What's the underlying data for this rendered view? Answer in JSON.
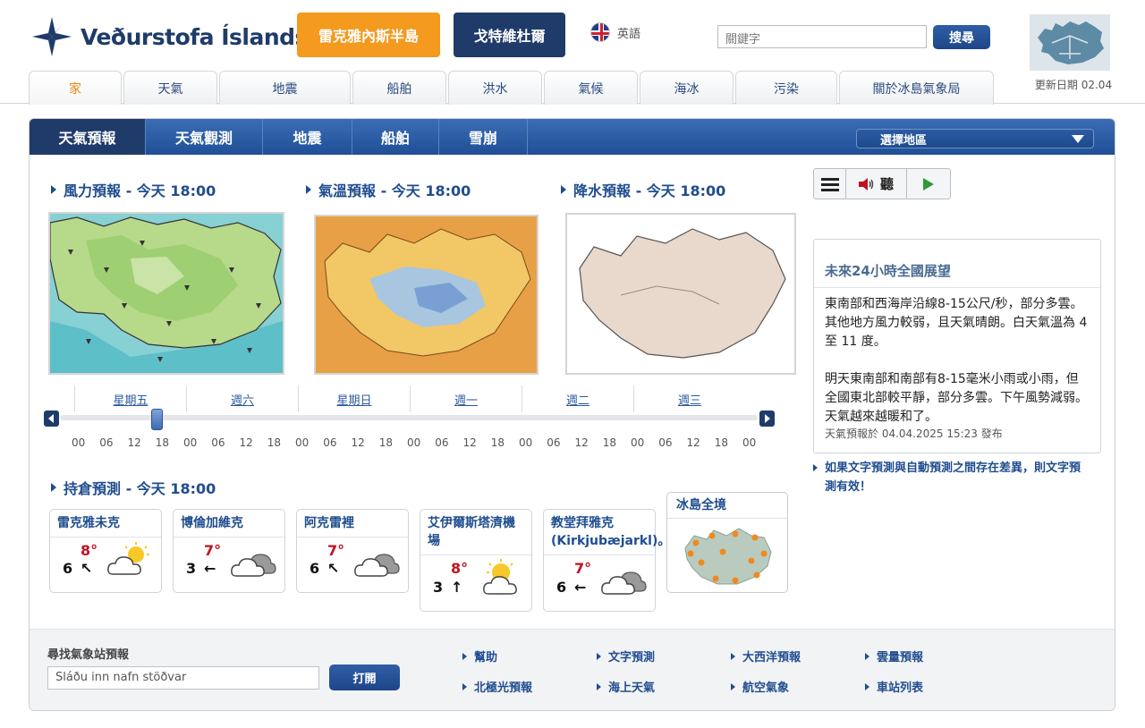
{
  "header": {
    "logo_text": "Veðurstofa Íslands",
    "btn_reykjanes": "雷克雅內斯半島",
    "btn_second": "戈特維杜爾",
    "language": "英語",
    "search_placeholder": "關鍵字",
    "search_button": "搜尋",
    "update": "更新日期 02.04"
  },
  "nav": {
    "tabs": [
      "家",
      "天氣",
      "地震",
      "船舶",
      "洪水",
      "氣候",
      "海冰",
      "污染",
      "關於冰島氣象局"
    ]
  },
  "subnav": {
    "tabs": [
      "天氣預報",
      "天氣觀測",
      "地震",
      "船舶",
      "雪崩"
    ],
    "region": "選擇地區"
  },
  "maps": {
    "wind_title": "風力預報 - 今天 18:00",
    "temp_title": "氣溫預報 - 今天 18:00",
    "precip_title": "降水預報 - 今天 18:00"
  },
  "timeline": {
    "days": [
      "星期五",
      "週六",
      "星期日",
      "週一",
      "週二",
      "週三"
    ],
    "hours": [
      "00",
      "06",
      "12",
      "18",
      "00",
      "06",
      "12",
      "18",
      "00",
      "06",
      "12",
      "18",
      "00",
      "06",
      "12",
      "18",
      "00",
      "06",
      "12",
      "18",
      "00",
      "06",
      "12",
      "18",
      "00"
    ]
  },
  "stations": {
    "title": "持倉預測 - 今天 18:00",
    "items": [
      {
        "name": "雷克雅未克",
        "temp": "8°",
        "wind": "6"
      },
      {
        "name": "博倫加維克",
        "temp": "7°",
        "wind": "3"
      },
      {
        "name": "阿克雷裡",
        "temp": "7°",
        "wind": "6"
      },
      {
        "name": "艾伊爾斯塔濟機場",
        "temp": "8°",
        "wind": "3"
      },
      {
        "name": "教堂拜雅克(Kirkjubæjarkl)。",
        "temp": "7°",
        "wind": "6"
      }
    ],
    "all_iceland": "冰島全境"
  },
  "toolbar": {
    "listen": "聽"
  },
  "outlook": {
    "title": "未來24小時全國展望",
    "para1": "東南部和西海岸沿線8-15公尺/秒，部分多雲。其他地方風力較弱，且天氣晴朗。白天氣溫為 4 至 11 度。",
    "para2": "明天東南部和南部有8-15毫米小雨或小雨，但全國東北部較平靜，部分多雲。下午風勢減弱。天氣越來越暖和了。",
    "footer": "天氣預報於 04.04.2025 15:23 發布",
    "note": "如果文字預測與自動預測之間存在差異，則文字預測有效！"
  },
  "footer": {
    "find_label": "尋找氣象站預報",
    "find_placeholder": "Sláðu inn nafn stöðvar",
    "open_button": "打開",
    "links": [
      "幫助",
      "文字預測",
      "大西洋預報",
      "雲量預報",
      "北極光預報",
      "海上天氣",
      "航空氣象",
      "車站列表"
    ]
  },
  "colors": {
    "brand_navy": "#1f3b6a",
    "accent_orange": "#f39a1f",
    "link_blue": "#1f4d8f",
    "temp_red": "#c1121f"
  }
}
